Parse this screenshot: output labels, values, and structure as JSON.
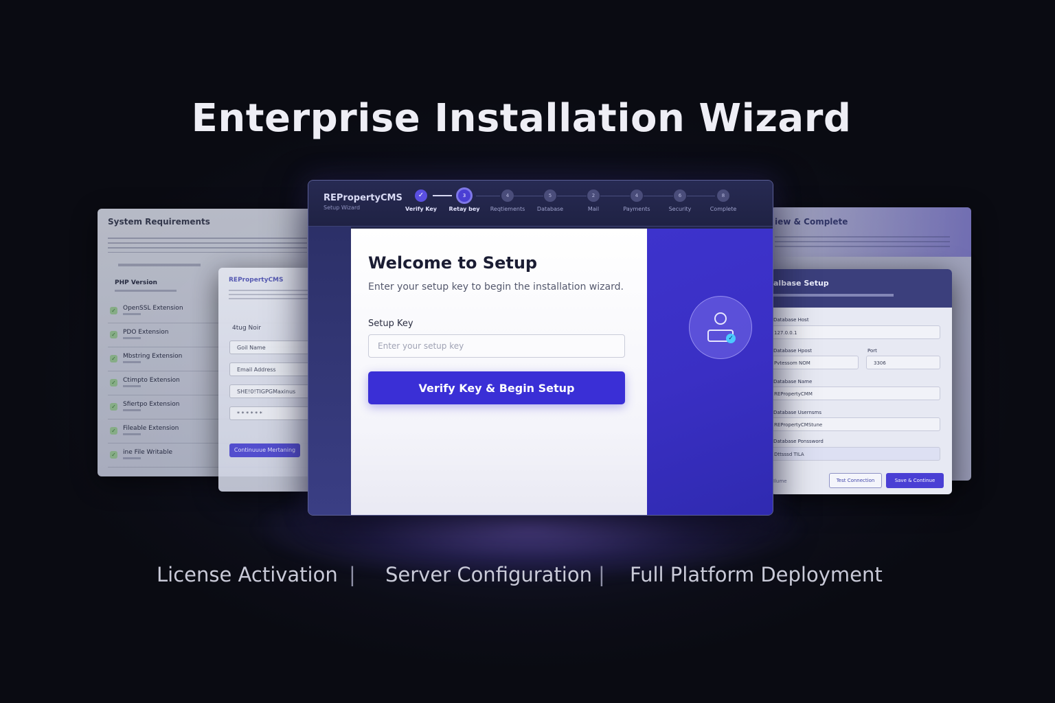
{
  "hero": {
    "title": "Enterprise Installation Wizard"
  },
  "features": [
    "License Activation",
    "Server Configuration",
    "Full Platform Deployment"
  ],
  "system_requirements": {
    "title": "System Requirements",
    "header_item": "PHP Version",
    "items": [
      "OpenSSL Extension",
      "PDO Extension",
      "Mbstring Extension",
      "Ctimpto Extension",
      "Sfiertpo Extension",
      "Fileable Extension",
      "ine File Writable"
    ]
  },
  "admin_panel": {
    "brand": "REPropertyCMS",
    "label": "4tug Noir",
    "fields": [
      "Goil Name",
      "Email Address",
      "SHE!0!TIGPGMaxinus",
      "* * * * * *"
    ],
    "button": "Continuuue Mertaning"
  },
  "review_panel": {
    "title": "iew & Complete"
  },
  "database_panel": {
    "title": "albase Setup",
    "host_label": "Database Host",
    "host_value": "127.0.0.1",
    "host2_label": "Database Hpost",
    "host2_value": "Pvtessom NOM",
    "port_label": "Port",
    "port_value": "3306",
    "name_label": "Database Name",
    "name_value": "REPropertyCMM",
    "user_label": "Database Usernsms",
    "user_value": "REPropertyCMStune",
    "password_label": "Database Ponssword",
    "password_value": "Dttsssd TILA",
    "footer_text": "Ilume",
    "test_button": "Test Connection",
    "save_button": "Save & Continue"
  },
  "wizard": {
    "brand": "REPropertyCMS",
    "subtitle": "Setup Wizard",
    "steps": [
      {
        "num": "✓",
        "label": "Verify Key",
        "state": "done"
      },
      {
        "num": "3",
        "label": "Retay bey",
        "state": "active"
      },
      {
        "num": "4",
        "label": "Reqtiements",
        "state": "pending"
      },
      {
        "num": "5",
        "label": "Database",
        "state": "pending"
      },
      {
        "num": "2",
        "label": "Mail",
        "state": "pending"
      },
      {
        "num": "4",
        "label": "Payments",
        "state": "pending"
      },
      {
        "num": "6",
        "label": "Security",
        "state": "pending"
      },
      {
        "num": "8",
        "label": "Complete",
        "state": "pending"
      }
    ],
    "welcome_title": "Welcome to Setup",
    "welcome_subtitle": "Enter your setup key to begin the installation wizard.",
    "key_label": "Setup Key",
    "key_placeholder": "Enter your setup key",
    "key_value": "",
    "verify_button": "Verify Key & Begin Setup"
  },
  "colors": {
    "accent": "#3a2fd6",
    "background": "#0c0d17",
    "panel_dark": "#23264a"
  }
}
